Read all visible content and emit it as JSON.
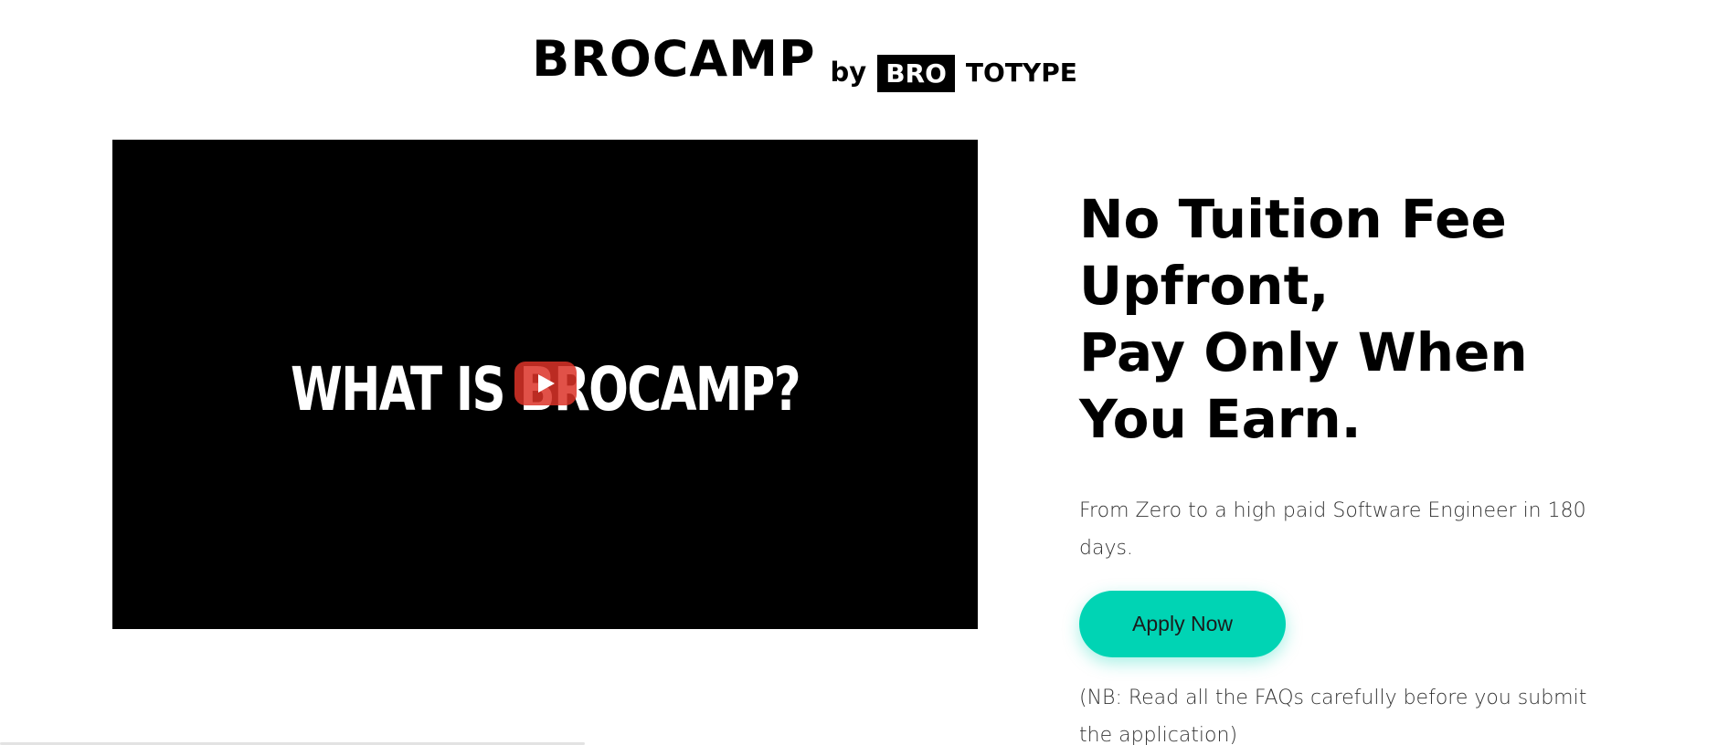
{
  "header": {
    "logo_main": "BROCAMP",
    "logo_by": "by",
    "logo_bro": "BRO",
    "logo_totype": "TOTYPE"
  },
  "video": {
    "title": "WHAT IS BROCAMP?",
    "play_icon": "play-icon"
  },
  "hero": {
    "headline": "No Tuition Fee\nUpfront,\nPay Only When\nYou Earn.",
    "subtext": "From Zero to a high paid Software Engineer in 180 days.",
    "apply_label": "Apply Now",
    "note": "(NB: Read all the FAQs carefully before you submit the application)"
  },
  "colors": {
    "accent": "#00d4b4",
    "text": "#000000",
    "muted_text": "#333333",
    "video_bg": "#000000",
    "play_button": "#dc3228"
  }
}
